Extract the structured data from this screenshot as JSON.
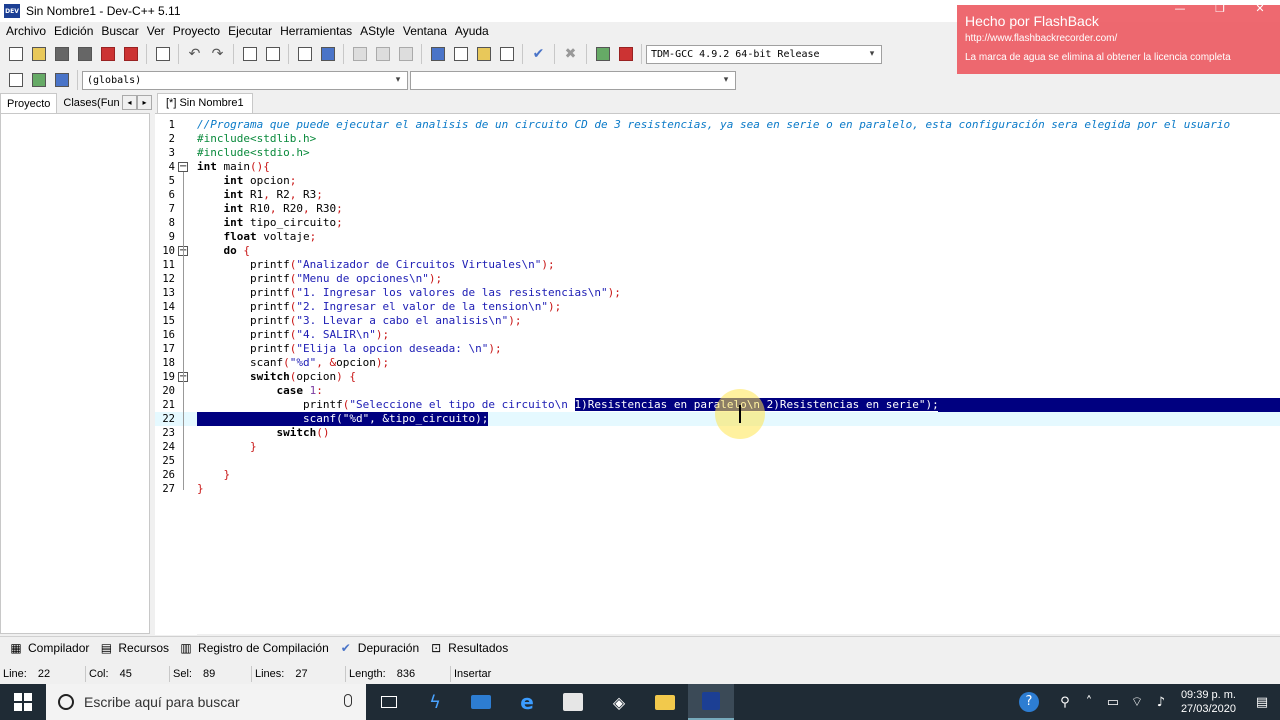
{
  "window": {
    "title": "Sin Nombre1 - Dev-C++ 5.11",
    "icon_text": "DEV"
  },
  "menu": [
    "Archivo",
    "Edición",
    "Buscar",
    "Ver",
    "Proyecto",
    "Ejecutar",
    "Herramientas",
    "AStyle",
    "Ventana",
    "Ayuda"
  ],
  "toolbar": {
    "compiler_select": "TDM-GCC 4.9.2 64-bit Release",
    "scope_select": "(globals)",
    "member_select": ""
  },
  "left_panel": {
    "tabs": [
      "Proyecto",
      "Clases(Fun"
    ]
  },
  "editor": {
    "tab": "[*] Sin Nombre1",
    "lines": [
      {
        "n": "1",
        "text": "//Programa que puede ejecutar el analisis de un circuito CD de 3 resistencias, ya sea en serie o en paralelo, esta configuración sera elegida por el usuario"
      },
      {
        "n": "2",
        "text": "#include<stdlib.h>"
      },
      {
        "n": "3",
        "text": "#include<stdio.h>"
      },
      {
        "n": "4",
        "text": "int main(){"
      },
      {
        "n": "5",
        "text": "    int opcion;"
      },
      {
        "n": "6",
        "text": "    int R1, R2, R3;"
      },
      {
        "n": "7",
        "text": "    int R10, R20, R30;"
      },
      {
        "n": "8",
        "text": "    int tipo_circuito;"
      },
      {
        "n": "9",
        "text": "    float voltaje;"
      },
      {
        "n": "10",
        "text": "    do {"
      },
      {
        "n": "11",
        "text": "        printf(\"Analizador de Circuitos Virtuales\\n\");"
      },
      {
        "n": "12",
        "text": "        printf(\"Menu de opciones\\n\");"
      },
      {
        "n": "13",
        "text": "        printf(\"1. Ingresar los valores de las resistencias\\n\");"
      },
      {
        "n": "14",
        "text": "        printf(\"2. Ingresar el valor de la tension\\n\");"
      },
      {
        "n": "15",
        "text": "        printf(\"3. Llevar a cabo el analisis\\n\");"
      },
      {
        "n": "16",
        "text": "        printf(\"4. SALIR\\n\");"
      },
      {
        "n": "17",
        "text": "        printf(\"Elija la opcion deseada: \\n\");"
      },
      {
        "n": "18",
        "text": "        scanf(\"%d\", &opcion);"
      },
      {
        "n": "19",
        "text": "        switch(opcion) {"
      },
      {
        "n": "20",
        "text": "            case 1:"
      },
      {
        "n": "21",
        "text": "                printf(\"Seleccione el tipo de circuito\\n 1)Resistencias en paralelo\\n 2)Resistencias en serie\");"
      },
      {
        "n": "22",
        "text": "                scanf(\"%d\", &tipo_circuito);"
      },
      {
        "n": "23",
        "text": "            switch()"
      },
      {
        "n": "24",
        "text": "        }"
      },
      {
        "n": "25",
        "text": ""
      },
      {
        "n": "26",
        "text": "    }"
      },
      {
        "n": "27",
        "text": "}"
      }
    ]
  },
  "bottom_tabs": [
    "Compilador",
    "Recursos",
    "Registro de Compilación",
    "Depuración",
    "Resultados"
  ],
  "status": {
    "line_label": "Line:",
    "line": "22",
    "col_label": "Col:",
    "col": "45",
    "sel_label": "Sel:",
    "sel": "89",
    "lines_label": "Lines:",
    "lines": "27",
    "length_label": "Length:",
    "length": "836",
    "mode": "Insertar"
  },
  "taskbar": {
    "search_placeholder": "Escribe aquí para buscar",
    "time": "09:39 p. m.",
    "date": "27/03/2020"
  },
  "watermark": {
    "title": "Hecho por FlashBack",
    "url": "http://www.flashbackrecorder.com/",
    "note": "La marca de agua se elimina al obtener la licencia completa"
  }
}
